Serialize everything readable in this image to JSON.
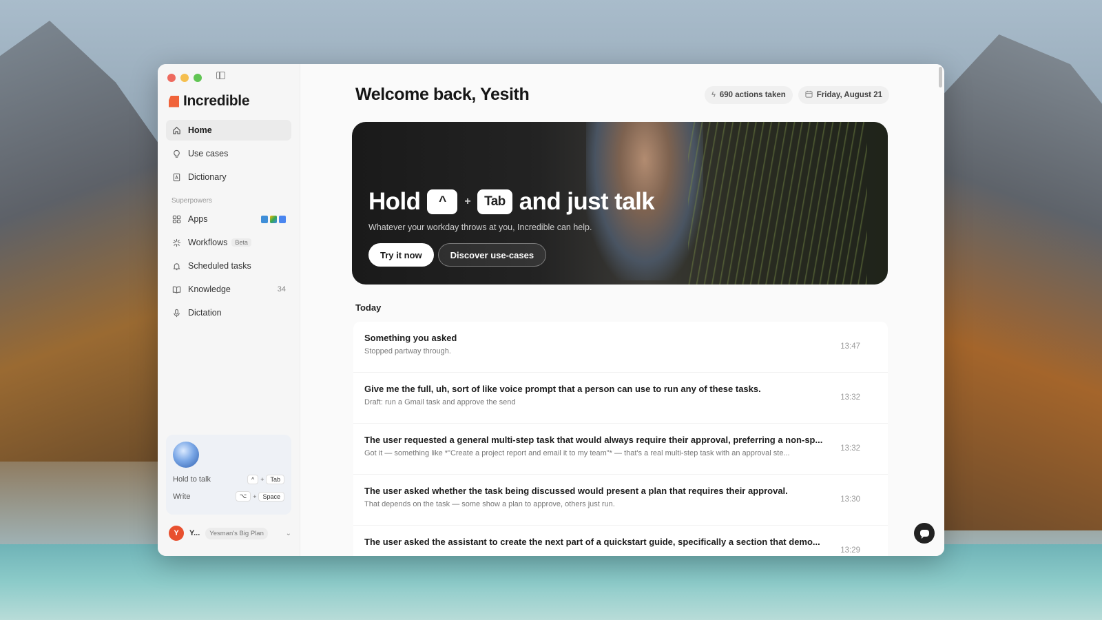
{
  "app": {
    "name": "Incredible",
    "brand_color": "#f0633a"
  },
  "sidebar": {
    "nav": [
      {
        "label": "Home",
        "icon": "home-icon",
        "active": true
      },
      {
        "label": "Use cases",
        "icon": "lightbulb-icon"
      },
      {
        "label": "Dictionary",
        "icon": "book-icon"
      }
    ],
    "section_label": "Superpowers",
    "superpowers": [
      {
        "label": "Apps",
        "icon": "grid-icon"
      },
      {
        "label": "Workflows",
        "icon": "sparkle-icon",
        "badge": "Beta"
      },
      {
        "label": "Scheduled tasks",
        "icon": "bell-icon"
      },
      {
        "label": "Knowledge",
        "icon": "open-book-icon",
        "count": "34"
      },
      {
        "label": "Dictation",
        "icon": "microphone-icon"
      }
    ],
    "talk_card": {
      "hold_label": "Hold to talk",
      "hold_keys": [
        "^",
        "+",
        "Tab"
      ],
      "write_label": "Write",
      "write_keys": [
        "⌥",
        "+",
        "Space"
      ]
    },
    "user": {
      "initial": "Y",
      "name": "Y...",
      "plan": "Yesman's Big Plan"
    }
  },
  "header": {
    "title": "Welcome back, Yesith",
    "actions_chip": "690 actions taken",
    "date_chip": "Friday, August 21"
  },
  "hero": {
    "title_start": "Hold",
    "key1": "^",
    "plus": "+",
    "key2": "Tab",
    "title_end": "and just talk",
    "subtitle": "Whatever your workday throws at you, Incredible can help.",
    "primary_button": "Try it now",
    "secondary_button": "Discover use-cases"
  },
  "today": {
    "title": "Today",
    "items": [
      {
        "title": "Something you asked",
        "subtitle": "Stopped partway through.",
        "time": "13:47"
      },
      {
        "title": "Give me the full, uh, sort of like voice prompt that a person can use to run any of these tasks.",
        "subtitle": "Draft: run a Gmail task and approve the send",
        "time": "13:32"
      },
      {
        "title": "The user requested a general multi-step task that would always require their approval, preferring a non-sp...",
        "subtitle": "Got it — something like *\"Create a project report and email it to my team\"* — that's a real multi-step task with an approval ste...",
        "time": "13:32"
      },
      {
        "title": "The user asked whether the task being discussed would present a plan that requires their approval.",
        "subtitle": "That depends on the task — some show a plan to approve, others just run.",
        "time": "13:30"
      },
      {
        "title": "The user asked the assistant to create the next part of a quickstart guide, specifically a section that demo...",
        "subtitle": "",
        "time": "13:29"
      }
    ]
  }
}
